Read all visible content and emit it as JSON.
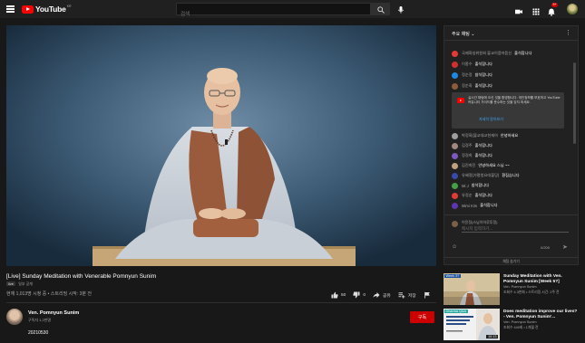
{
  "header": {
    "logo_text": "YouTube",
    "logo_sup": "KR",
    "search_placeholder": "검색",
    "notification_count": "9+"
  },
  "video": {
    "title": "[Live] Sunday Meditation with Venerable Pomnyun Sunim",
    "tags": [
      "live",
      "일부 공개"
    ],
    "meta": "현재 1,013명 시청 중 • 스트리밍 시작: 3분 전",
    "like_count": "50",
    "dislike_count": "0",
    "share_label": "공유",
    "save_label": "저장"
  },
  "channel": {
    "name": "Ven. Pomnyun Sunim",
    "subscribers": "구독자 1.2만명",
    "subscribe_label": "구독",
    "date_line": "20210530"
  },
  "chat": {
    "header_title": "주요 채팅",
    "messages_top": [
      {
        "author": "국제화실위원회 불교이음마음신",
        "text": "출석합니다",
        "color": "#e53935"
      },
      {
        "author": "이종수",
        "text": "출석합니다",
        "color": "#d32f2f"
      },
      {
        "author": "정순정",
        "text": "참석합니다",
        "color": "#1e88e5"
      },
      {
        "author": "정순화",
        "text": "출석합니다",
        "color": "#8e5a3c"
      }
    ],
    "notice_text": "실시간 채팅에 오신 것을 환영합니다. 개인정보를 보호하고 YouTube 커뮤니티 가이드를 준수하는 것을 잊지 마세요.",
    "notice_link": "자세히 알아보기",
    "messages_bottom": [
      {
        "author": "박정화(불교대교현재아",
        "text": "안녕하세요",
        "color": "#9e9e9e"
      },
      {
        "author": "김경주",
        "text": "출석합니다",
        "color": "#a1887f"
      },
      {
        "author": "정경희",
        "text": "출석합니다",
        "color": "#7e57c2"
      },
      {
        "author": "김진희진",
        "text": "안녕하세요 스님 ~~",
        "color": "#c0a080"
      },
      {
        "author": "유혜정(가평청요대불당)",
        "text": "환집습니다",
        "color": "#3949ab"
      },
      {
        "author": "Mi J",
        "text": "참석합니다",
        "color": "#43a047"
      },
      {
        "author": "유정순",
        "text": "출석합니다",
        "color": "#e53935"
      },
      {
        "author": "Mimi Kim",
        "text": "출석합니다",
        "color": "#5e35b1"
      }
    ],
    "input_name": "이윤정(스님이하루투정)",
    "input_placeholder": "메시지 입력하기...",
    "char_count": "0/200",
    "footer": "채팅 숨기기"
  },
  "recommendations": [
    {
      "title": "Sunday Meditation with Ven. Pomnyun Sunim [Week 5?]",
      "channel": "Ven. Pomnyun Sunim",
      "meta": "조회수 4.3천회 • 스트리밍 시간: 2주 전",
      "badge": "Week 5?",
      "duration": ""
    },
    {
      "title": "Does meditation improve our lives? - Ven. Pomnyun Sunim'...",
      "channel": "Ven. Pomnyun Sunim",
      "meta": "조회수 440회 • 1개월 전",
      "badge": "Dharma Q&A",
      "duration": "10:13"
    }
  ],
  "colors": {
    "background": "#181818",
    "accent": "#cc0000",
    "link": "#3ea6ff"
  }
}
